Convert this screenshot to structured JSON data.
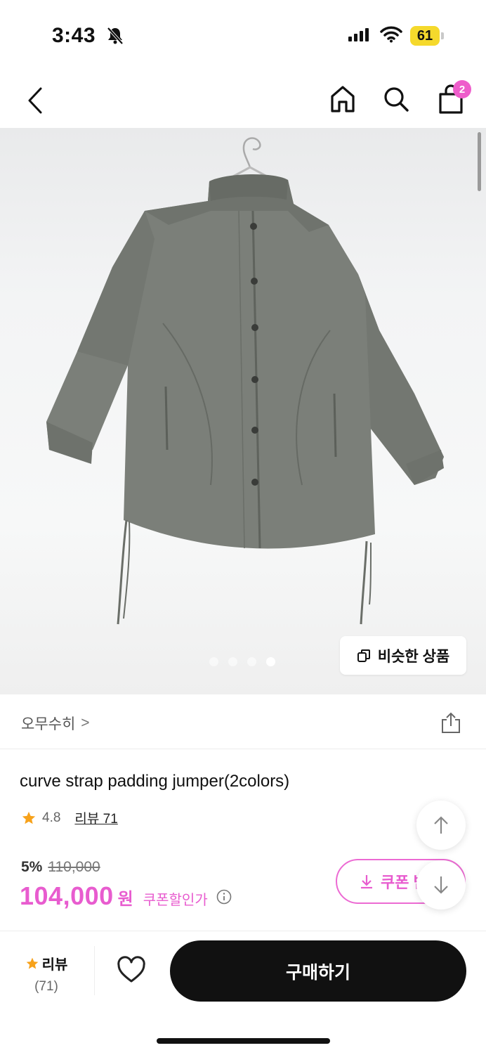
{
  "status_bar": {
    "time": "3:43",
    "battery": "61"
  },
  "header": {
    "cart_count": "2"
  },
  "gallery": {
    "similar_button": "비슷한 상품",
    "dot_count": 4,
    "active_dot": 4
  },
  "brand": {
    "name": "오무수히",
    "chevron": ">"
  },
  "product": {
    "title": "curve strap padding jumper(2colors)",
    "rating": "4.8",
    "review_link": "리뷰 71",
    "discount_rate": "5%",
    "original_price": "110,000",
    "price": "104,000",
    "currency": "원",
    "coupon_price_label": "쿠폰할인가"
  },
  "coupon_button": {
    "label": "쿠폰 받기"
  },
  "bottom_bar": {
    "review_label": "리뷰",
    "review_count": "(71)",
    "buy_label": "구매하기"
  },
  "colors": {
    "accent": "#e85ccf",
    "star": "#f7a21b",
    "dark": "#111111"
  }
}
